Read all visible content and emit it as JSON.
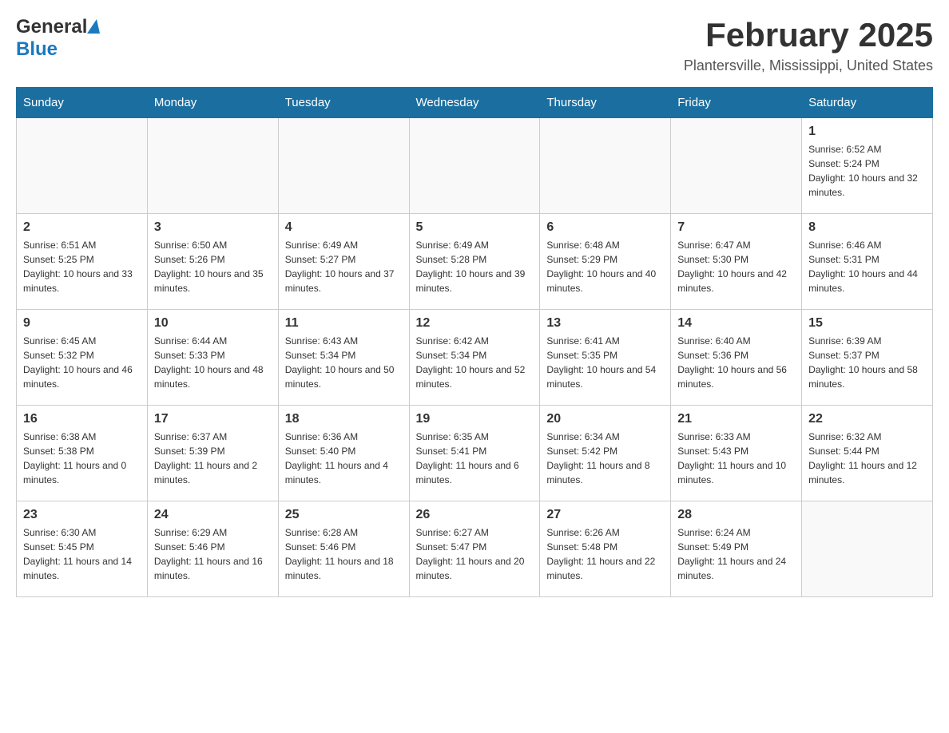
{
  "header": {
    "logo_general": "General",
    "logo_blue": "Blue",
    "month_title": "February 2025",
    "location": "Plantersville, Mississippi, United States"
  },
  "days_of_week": [
    "Sunday",
    "Monday",
    "Tuesday",
    "Wednesday",
    "Thursday",
    "Friday",
    "Saturday"
  ],
  "weeks": [
    [
      {
        "day": "",
        "sunrise": "",
        "sunset": "",
        "daylight": ""
      },
      {
        "day": "",
        "sunrise": "",
        "sunset": "",
        "daylight": ""
      },
      {
        "day": "",
        "sunrise": "",
        "sunset": "",
        "daylight": ""
      },
      {
        "day": "",
        "sunrise": "",
        "sunset": "",
        "daylight": ""
      },
      {
        "day": "",
        "sunrise": "",
        "sunset": "",
        "daylight": ""
      },
      {
        "day": "",
        "sunrise": "",
        "sunset": "",
        "daylight": ""
      },
      {
        "day": "1",
        "sunrise": "Sunrise: 6:52 AM",
        "sunset": "Sunset: 5:24 PM",
        "daylight": "Daylight: 10 hours and 32 minutes."
      }
    ],
    [
      {
        "day": "2",
        "sunrise": "Sunrise: 6:51 AM",
        "sunset": "Sunset: 5:25 PM",
        "daylight": "Daylight: 10 hours and 33 minutes."
      },
      {
        "day": "3",
        "sunrise": "Sunrise: 6:50 AM",
        "sunset": "Sunset: 5:26 PM",
        "daylight": "Daylight: 10 hours and 35 minutes."
      },
      {
        "day": "4",
        "sunrise": "Sunrise: 6:49 AM",
        "sunset": "Sunset: 5:27 PM",
        "daylight": "Daylight: 10 hours and 37 minutes."
      },
      {
        "day": "5",
        "sunrise": "Sunrise: 6:49 AM",
        "sunset": "Sunset: 5:28 PM",
        "daylight": "Daylight: 10 hours and 39 minutes."
      },
      {
        "day": "6",
        "sunrise": "Sunrise: 6:48 AM",
        "sunset": "Sunset: 5:29 PM",
        "daylight": "Daylight: 10 hours and 40 minutes."
      },
      {
        "day": "7",
        "sunrise": "Sunrise: 6:47 AM",
        "sunset": "Sunset: 5:30 PM",
        "daylight": "Daylight: 10 hours and 42 minutes."
      },
      {
        "day": "8",
        "sunrise": "Sunrise: 6:46 AM",
        "sunset": "Sunset: 5:31 PM",
        "daylight": "Daylight: 10 hours and 44 minutes."
      }
    ],
    [
      {
        "day": "9",
        "sunrise": "Sunrise: 6:45 AM",
        "sunset": "Sunset: 5:32 PM",
        "daylight": "Daylight: 10 hours and 46 minutes."
      },
      {
        "day": "10",
        "sunrise": "Sunrise: 6:44 AM",
        "sunset": "Sunset: 5:33 PM",
        "daylight": "Daylight: 10 hours and 48 minutes."
      },
      {
        "day": "11",
        "sunrise": "Sunrise: 6:43 AM",
        "sunset": "Sunset: 5:34 PM",
        "daylight": "Daylight: 10 hours and 50 minutes."
      },
      {
        "day": "12",
        "sunrise": "Sunrise: 6:42 AM",
        "sunset": "Sunset: 5:34 PM",
        "daylight": "Daylight: 10 hours and 52 minutes."
      },
      {
        "day": "13",
        "sunrise": "Sunrise: 6:41 AM",
        "sunset": "Sunset: 5:35 PM",
        "daylight": "Daylight: 10 hours and 54 minutes."
      },
      {
        "day": "14",
        "sunrise": "Sunrise: 6:40 AM",
        "sunset": "Sunset: 5:36 PM",
        "daylight": "Daylight: 10 hours and 56 minutes."
      },
      {
        "day": "15",
        "sunrise": "Sunrise: 6:39 AM",
        "sunset": "Sunset: 5:37 PM",
        "daylight": "Daylight: 10 hours and 58 minutes."
      }
    ],
    [
      {
        "day": "16",
        "sunrise": "Sunrise: 6:38 AM",
        "sunset": "Sunset: 5:38 PM",
        "daylight": "Daylight: 11 hours and 0 minutes."
      },
      {
        "day": "17",
        "sunrise": "Sunrise: 6:37 AM",
        "sunset": "Sunset: 5:39 PM",
        "daylight": "Daylight: 11 hours and 2 minutes."
      },
      {
        "day": "18",
        "sunrise": "Sunrise: 6:36 AM",
        "sunset": "Sunset: 5:40 PM",
        "daylight": "Daylight: 11 hours and 4 minutes."
      },
      {
        "day": "19",
        "sunrise": "Sunrise: 6:35 AM",
        "sunset": "Sunset: 5:41 PM",
        "daylight": "Daylight: 11 hours and 6 minutes."
      },
      {
        "day": "20",
        "sunrise": "Sunrise: 6:34 AM",
        "sunset": "Sunset: 5:42 PM",
        "daylight": "Daylight: 11 hours and 8 minutes."
      },
      {
        "day": "21",
        "sunrise": "Sunrise: 6:33 AM",
        "sunset": "Sunset: 5:43 PM",
        "daylight": "Daylight: 11 hours and 10 minutes."
      },
      {
        "day": "22",
        "sunrise": "Sunrise: 6:32 AM",
        "sunset": "Sunset: 5:44 PM",
        "daylight": "Daylight: 11 hours and 12 minutes."
      }
    ],
    [
      {
        "day": "23",
        "sunrise": "Sunrise: 6:30 AM",
        "sunset": "Sunset: 5:45 PM",
        "daylight": "Daylight: 11 hours and 14 minutes."
      },
      {
        "day": "24",
        "sunrise": "Sunrise: 6:29 AM",
        "sunset": "Sunset: 5:46 PM",
        "daylight": "Daylight: 11 hours and 16 minutes."
      },
      {
        "day": "25",
        "sunrise": "Sunrise: 6:28 AM",
        "sunset": "Sunset: 5:46 PM",
        "daylight": "Daylight: 11 hours and 18 minutes."
      },
      {
        "day": "26",
        "sunrise": "Sunrise: 6:27 AM",
        "sunset": "Sunset: 5:47 PM",
        "daylight": "Daylight: 11 hours and 20 minutes."
      },
      {
        "day": "27",
        "sunrise": "Sunrise: 6:26 AM",
        "sunset": "Sunset: 5:48 PM",
        "daylight": "Daylight: 11 hours and 22 minutes."
      },
      {
        "day": "28",
        "sunrise": "Sunrise: 6:24 AM",
        "sunset": "Sunset: 5:49 PM",
        "daylight": "Daylight: 11 hours and 24 minutes."
      },
      {
        "day": "",
        "sunrise": "",
        "sunset": "",
        "daylight": ""
      }
    ]
  ]
}
